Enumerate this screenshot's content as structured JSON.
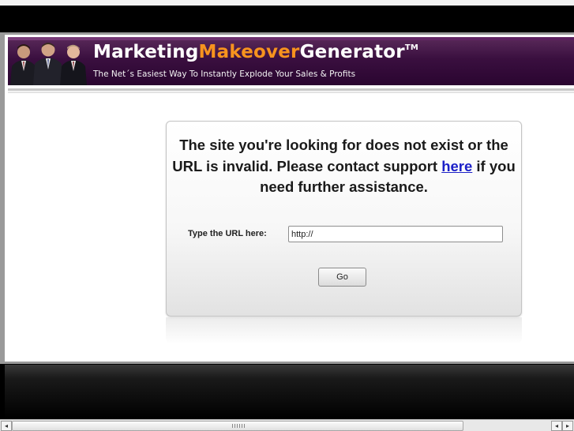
{
  "header": {
    "brand_part1": "Marketing",
    "brand_part2": "Makeover",
    "brand_part3": "Generator",
    "trademark": "TM",
    "tagline": "The Net´s Easiest Way To Instantly Explode Your Sales & Profits"
  },
  "error_box": {
    "message_before": "The site you're looking for does not exist or the URL is invalid. Please contact support ",
    "link_text": "here",
    "message_after": " if you need further assistance.",
    "url_label": "Type the URL here:",
    "url_value": "http://",
    "go_label": "Go"
  },
  "scrollbar": {
    "left_arrow": "◂",
    "right_arrow_1": "◂",
    "right_arrow_2": "▸"
  },
  "colors": {
    "banner_purple": "#3a0f3f",
    "brand_orange": "#f7931e",
    "link_blue": "#1c20c8"
  },
  "icons": {
    "header_image": "three-businessmen-photo",
    "scroll_left": "arrow-left-icon",
    "scroll_right": "arrow-right-icon"
  }
}
